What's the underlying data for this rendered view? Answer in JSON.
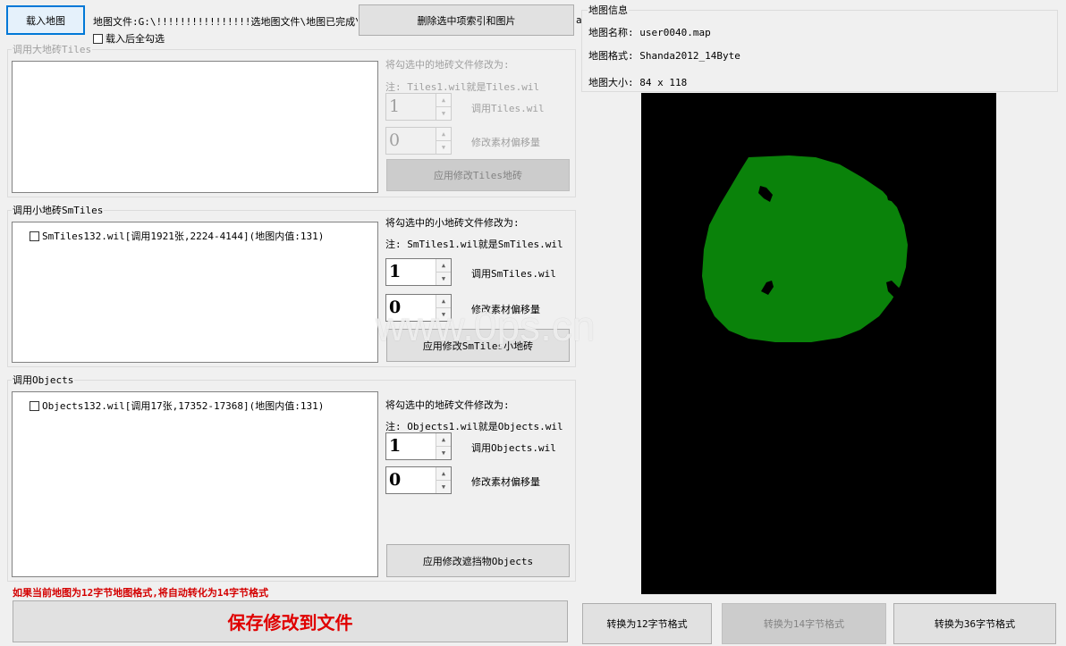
{
  "top": {
    "load_map_label": "载入地图",
    "file_path": "地图文件:G:\\!!!!!!!!!!!!!!!!选地图文件\\地图已完成\\",
    "select_all_label": "载入后全勾选",
    "delete_label": "删除选中项索引和图片",
    "truncated_char": "a"
  },
  "tiles": {
    "title": "调用大地砖Tiles",
    "modify_label": "将勾选中的地砖文件修改为:",
    "note": "注: Tiles1.wil就是Tiles.wil",
    "spin1_value": "1",
    "spin1_label": "调用Tiles.wil",
    "spin2_value": "0",
    "spin2_label": "修改素材偏移量",
    "apply_label": "应用修改Tiles地砖"
  },
  "smtiles": {
    "title": "调用小地砖SmTiles",
    "item": "SmTiles132.wil[调用1921张,2224-4144](地图内值:131)",
    "modify_label": "将勾选中的小地砖文件修改为:",
    "note": "注: SmTiles1.wil就是SmTiles.wil",
    "spin1_value": "1",
    "spin1_label": "调用SmTiles.wil",
    "spin2_value": "0",
    "spin2_label": "修改素材偏移量",
    "apply_label": "应用修改SmTiles小地砖"
  },
  "objects": {
    "title": "调用Objects",
    "item": "Objects132.wil[调用17张,17352-17368](地图内值:131)",
    "modify_label": "将勾选中的地砖文件修改为:",
    "note": "注: Objects1.wil就是Objects.wil",
    "spin1_value": "1",
    "spin1_label": "调用Objects.wil",
    "spin2_value": "0",
    "spin2_label": "修改素材偏移量",
    "apply_label": "应用修改遮挡物Objects"
  },
  "map_info": {
    "title": "地图信息",
    "name": "地图名称: user0040.map",
    "format": "地图格式: Shanda2012_14Byte",
    "size": "地图大小: 84 x 118"
  },
  "map_preview": {
    "background": "#000000",
    "blob_color": "#0a820a"
  },
  "watermark": "www.0ps.cn",
  "warning": "如果当前地图为12字节地图格式,将自动转化为14字节格式",
  "save_label": "保存修改到文件",
  "convert": {
    "to12": "转换为12字节格式",
    "to14": "转换为14字节格式",
    "to36": "转换为36字节格式"
  }
}
